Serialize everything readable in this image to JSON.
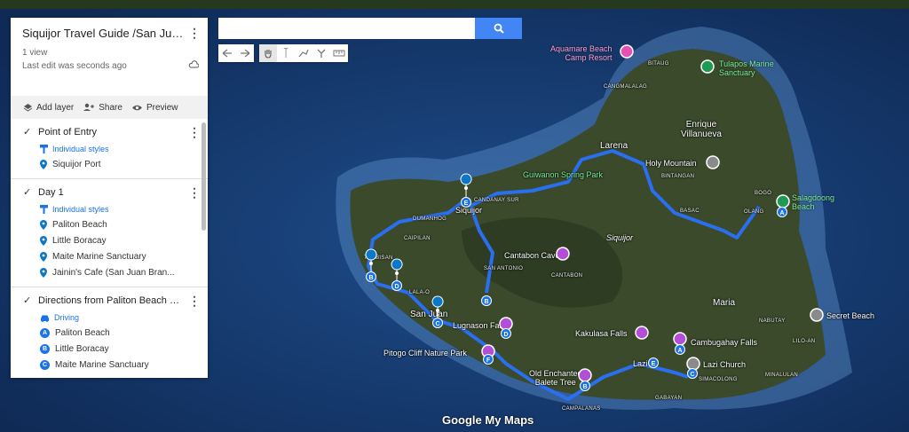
{
  "map_title": "Siquijor Travel Guide /San Juan B...",
  "views": "1 view",
  "last_edit": "Last edit was seconds ago",
  "actions": {
    "add_layer": "Add layer",
    "share": "Share",
    "preview": "Preview"
  },
  "layers": [
    {
      "name": "Point of Entry",
      "style": "Individual styles",
      "items": [
        "Siquijor Port"
      ]
    },
    {
      "name": "Day 1",
      "style": "Individual styles",
      "items": [
        "Paliton Beach",
        "Little Boracay",
        "Maite Marine Sanctuary",
        "Jainin's Cafe (San Juan Bran..."
      ]
    },
    {
      "name": "Directions from Paliton Beach to ...",
      "style": "Driving",
      "items": [
        {
          "letter": "A",
          "label": "Paliton Beach"
        },
        {
          "letter": "B",
          "label": "Little Boracay"
        },
        {
          "letter": "C",
          "label": "Maite Marine Sanctuary"
        }
      ]
    }
  ],
  "search": {
    "placeholder": ""
  },
  "map_labels": {
    "aquamare": "Aquamare Beach\nCamp Resort",
    "tulapos": "Tulapos Marine\nSanctuary",
    "bitaug": "BITAUG",
    "cangmalalag": "CANGMALALAG",
    "enrique": "Enrique\nVillanueva",
    "larena": "Larena",
    "holy": "Holy Mountain",
    "bintangan": "BINTANGAN",
    "guiwanon": "Guiwanon Spring Park",
    "bogo": "BOGO",
    "salagdoong": "Salagdoong\nBeach",
    "siquijor_town": "Siquijor",
    "candanay": "CANDANAY SUR",
    "dumanhog": "DUMANHOG",
    "caipilan": "CAIPILAN",
    "basac": "BASAC",
    "olang": "OLANG",
    "cantabon_cave": "Cantabon Cave",
    "siquijor_island": "Siquijor",
    "san_antonio": "SAN ANTONIO",
    "cantabon": "CANTABON",
    "tambisan": "TAMBISAN",
    "lala": "LALA-O",
    "maria": "Maria",
    "secret": "Secret Beach",
    "nabutay": "NABUTAY",
    "san_juan": "San Juan",
    "lugnason": "Lugnason Falls",
    "kakulasa": "Kakulasa Falls",
    "cambugahay": "Cambugahay Falls",
    "lilo": "LILO-AN",
    "pitogo": "Pitogo Cliff Nature Park",
    "lazi": "Lazi Church",
    "balete": "Old Enchanted\nBalete Tree",
    "simacolong": "SIMACOLONG",
    "minalulan": "MINALULAN",
    "lazi_town": "Lazi",
    "gabayan": "GABAYAN",
    "campalanas": "CAMPALANAS"
  },
  "markers": [
    "A",
    "B",
    "C",
    "D",
    "E",
    "F",
    "B",
    "C",
    "D",
    "E",
    "A",
    "B"
  ],
  "logo": "Google My Maps",
  "colors": {
    "route": "#2a6ff0",
    "accent": "#4285f4",
    "land": "#3b4a2c"
  }
}
